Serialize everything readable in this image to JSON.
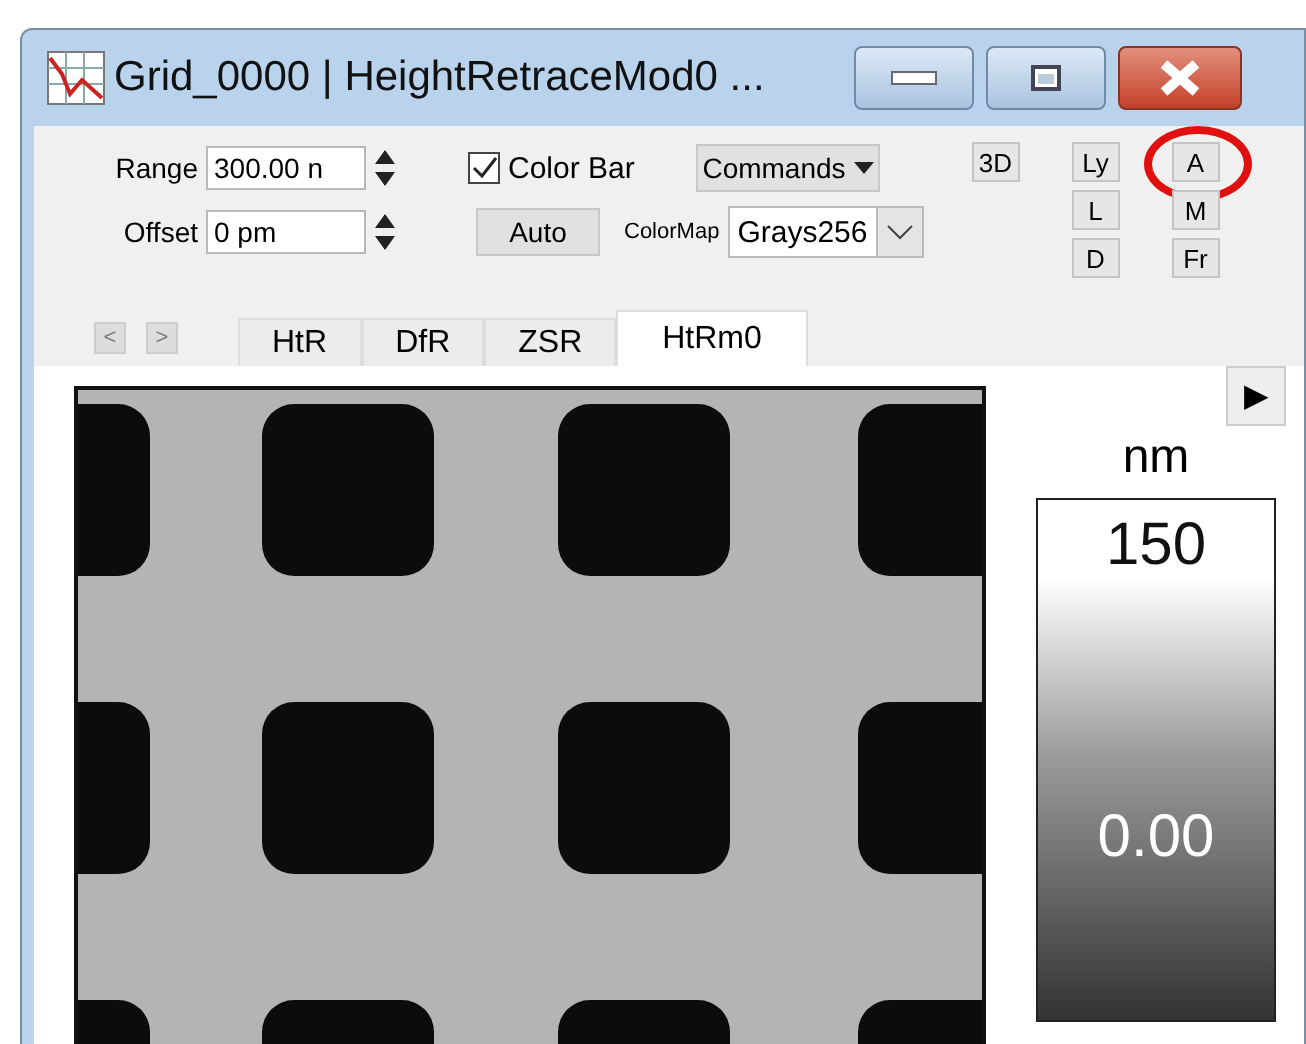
{
  "window": {
    "title": "Grid_0000  |  HeightRetraceMod0 ..."
  },
  "toolbar": {
    "range": {
      "label": "Range",
      "value": "300.00 n"
    },
    "offset": {
      "label": "Offset",
      "value": "0 pm"
    },
    "color_bar": {
      "label": "Color Bar",
      "checked": true
    },
    "commands": "Commands",
    "auto": "Auto",
    "colormap": {
      "label": "ColorMap",
      "value": "Grays256"
    },
    "side_buttons": [
      [
        {
          "label": "3D",
          "circled": false
        }
      ],
      [
        {
          "label": "Ly",
          "circled": false
        },
        {
          "label": "L",
          "circled": false
        },
        {
          "label": "D",
          "circled": false
        }
      ],
      [
        {
          "label": "A",
          "circled": true
        },
        {
          "label": "M",
          "circled": false
        },
        {
          "label": "Fr",
          "circled": false
        }
      ]
    ]
  },
  "nav": [
    "<",
    ">"
  ],
  "tabs": [
    {
      "label": "HtR",
      "selected": false
    },
    {
      "label": "DfR",
      "selected": false
    },
    {
      "label": "ZSR",
      "selected": false
    },
    {
      "label": "HtRm0",
      "selected": true
    }
  ],
  "expand": "▶",
  "color_scale": {
    "unit": "nm",
    "max": "150",
    "min": "0.00"
  }
}
